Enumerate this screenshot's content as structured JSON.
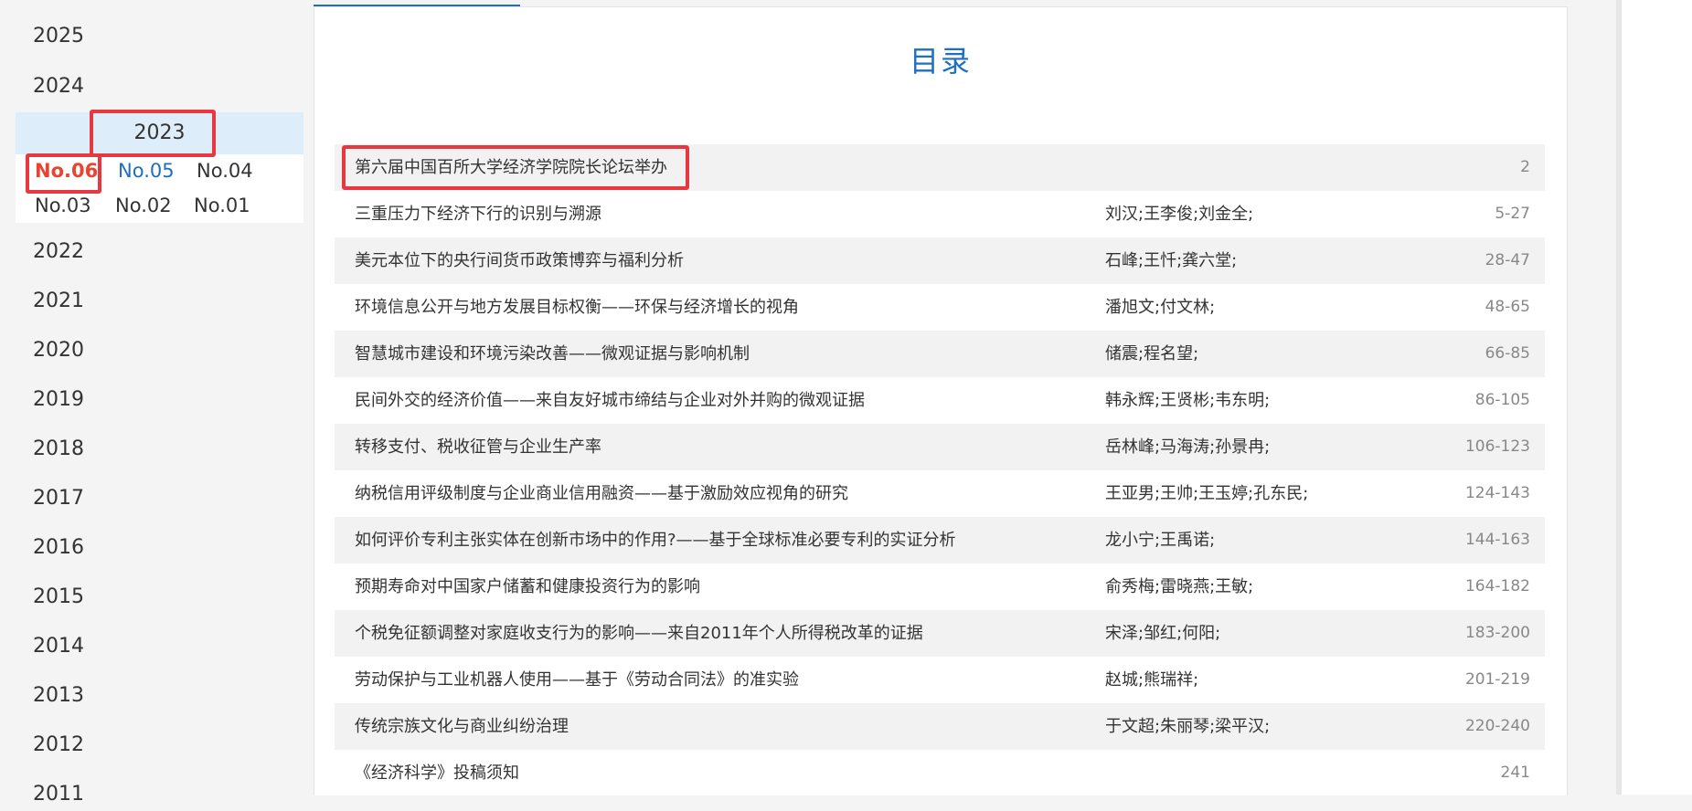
{
  "sidebar": {
    "years_before": [
      "2025",
      "2024"
    ],
    "active_year": "2023",
    "issues": [
      "No.06",
      "No.05",
      "No.04",
      "No.03",
      "No.02",
      "No.01"
    ],
    "years_after": [
      "2022",
      "2021",
      "2020",
      "2019",
      "2018",
      "2017",
      "2016",
      "2015",
      "2014",
      "2013",
      "2012",
      "2011"
    ]
  },
  "toc": {
    "heading": "目录",
    "rows": [
      {
        "title": "第六届中国百所大学经济学院院长论坛举办",
        "authors": "",
        "pages": "2"
      },
      {
        "title": "三重压力下经济下行的识别与溯源",
        "authors": "刘汉;王李俊;刘金全;",
        "pages": "5-27"
      },
      {
        "title": "美元本位下的央行间货币政策博弈与福利分析",
        "authors": "石峰;王忏;龚六堂;",
        "pages": "28-47"
      },
      {
        "title": "环境信息公开与地方发展目标权衡——环保与经济增长的视角",
        "authors": "潘旭文;付文林;",
        "pages": "48-65"
      },
      {
        "title": "智慧城市建设和环境污染改善——微观证据与影响机制",
        "authors": "储震;程名望;",
        "pages": "66-85"
      },
      {
        "title": "民间外交的经济价值——来自友好城市缔结与企业对外并购的微观证据",
        "authors": "韩永辉;王贤彬;韦东明;",
        "pages": "86-105"
      },
      {
        "title": "转移支付、税收征管与企业生产率",
        "authors": "岳林峰;马海涛;孙景冉;",
        "pages": "106-123"
      },
      {
        "title": "纳税信用评级制度与企业商业信用融资——基于激励效应视角的研究",
        "authors": "王亚男;王帅;王玉婷;孔东民;",
        "pages": "124-143"
      },
      {
        "title": "如何评价专利主张实体在创新市场中的作用?——基于全球标准必要专利的实证分析",
        "authors": "龙小宁;王禹诺;",
        "pages": "144-163"
      },
      {
        "title": "预期寿命对中国家户储蓄和健康投资行为的影响",
        "authors": "俞秀梅;雷晓燕;王敏;",
        "pages": "164-182"
      },
      {
        "title": "个税免征额调整对家庭收支行为的影响——来自2011年个人所得税改革的证据",
        "authors": "宋泽;邹红;何阳;",
        "pages": "183-200"
      },
      {
        "title": "劳动保护与工业机器人使用——基于《劳动合同法》的准实验",
        "authors": "赵城;熊瑞祥;",
        "pages": "201-219"
      },
      {
        "title": "传统宗族文化与商业纠纷治理",
        "authors": "于文超;朱丽琴;梁平汉;",
        "pages": "220-240"
      },
      {
        "title": "《经济科学》投稿须知",
        "authors": "",
        "pages": "241"
      }
    ]
  },
  "colors": {
    "accent": "#1e6fc0",
    "current_issue": "#e8442f",
    "highlight_box": "#e8383f",
    "active_year_bg": "#ddeefa"
  }
}
